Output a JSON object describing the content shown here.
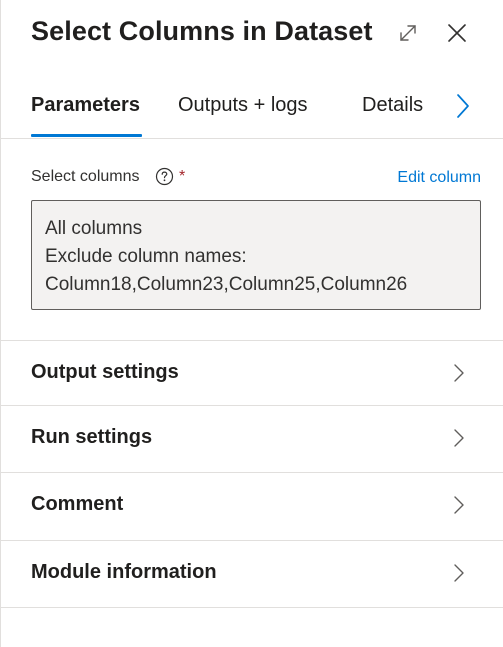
{
  "header": {
    "title": "Select Columns in Dataset",
    "expand_icon": "expand-diagonal-icon",
    "close_icon": "close-icon"
  },
  "tabs": [
    {
      "label": "Parameters",
      "active": true
    },
    {
      "label": "Outputs + logs",
      "active": false
    },
    {
      "label": "Details",
      "active": false
    }
  ],
  "tabs_scroll_icon": "chevron-right-icon",
  "parameters": {
    "select_columns_label": "Select columns",
    "required_marker": "*",
    "help_icon": "help-circle-icon",
    "edit_link": "Edit column",
    "value_lines": [
      "All columns",
      "Exclude column names:",
      "Column18,Column23,Column25,Column26"
    ]
  },
  "sections": [
    {
      "label": "Output settings"
    },
    {
      "label": "Run settings"
    },
    {
      "label": "Comment"
    },
    {
      "label": "Module information"
    }
  ],
  "colors": {
    "accent": "#0078d4",
    "required": "#a4262c",
    "divider": "#e1dfdd",
    "input_bg": "#f3f2f1",
    "input_border": "#605e5c"
  }
}
